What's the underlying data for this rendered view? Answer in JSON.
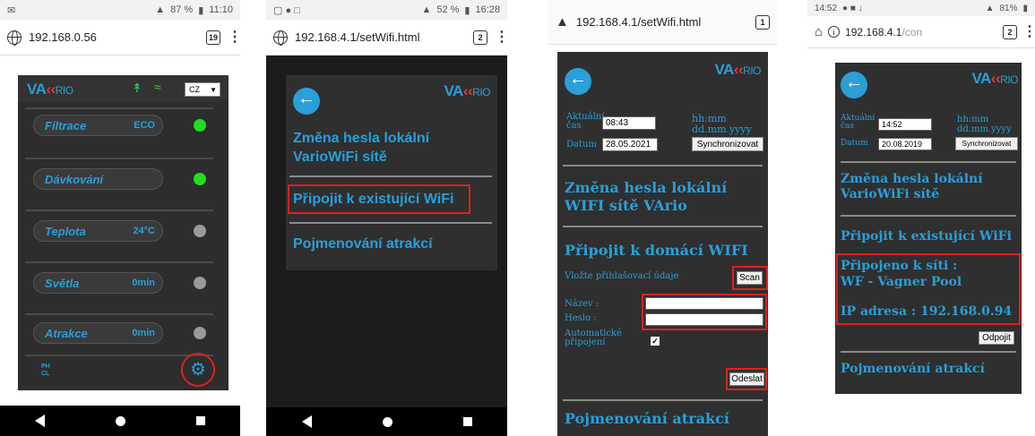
{
  "colors": {
    "accent": "#2a9fd8",
    "green": "#22dd22",
    "grey_dot": "#9a9a9a",
    "highlight": "#e0201e",
    "panel": "#2f2f2f"
  },
  "phone1": {
    "status_time": "11:10",
    "status_battery": "87 %",
    "url": "192.168.0.56",
    "tab_count": "19",
    "logo": {
      "va": "VA",
      "rio": "RIO"
    },
    "language": "CZ",
    "rows": [
      {
        "label": "Filtrace",
        "value": "ECO",
        "status": "on"
      },
      {
        "label": "Dávkování",
        "value": "",
        "status": "on"
      },
      {
        "label": "Teplota",
        "value": "24°C",
        "status": "off"
      },
      {
        "label": "Světla",
        "value": "0min",
        "status": "off"
      },
      {
        "label": "Atrakce",
        "value": "0min",
        "status": "off"
      }
    ],
    "ph_icon": "PH CL",
    "settings_icon": "gear-icon"
  },
  "phone2": {
    "status_time": "16:28",
    "status_battery": "52 %",
    "url": "192.168.4.1/setWifi.html",
    "tab_count": "2",
    "menu": [
      "Změna hesla lokální VarioWiFi sítě",
      "Připojit k existující WiFi",
      "Pojmenování atrakcí"
    ]
  },
  "phone3": {
    "url": "192.168.4.1/setWifi.html",
    "tab_count": "1",
    "time_label": "Aktuální čas",
    "time_value": "08:43",
    "time_format": "hh:mm",
    "date_label": "Datum",
    "date_value": "28.05.2021",
    "date_format": "dd.mm.yyyy",
    "sync_button": "Synchronizovat",
    "section1": "Změna hesla lokální WIFI sítě VArio",
    "section2": "Připojit k domácí WIFI",
    "login_prompt": "Vložte přihlašovací údaje",
    "scan_button": "Scan",
    "name_label": "Název :",
    "name_value": "",
    "password_label": "Heslo :",
    "password_value": "",
    "auto_label": "Automatické připojení",
    "auto_checked": true,
    "send_button": "Odeslat",
    "section3": "Pojmenování atrakcí"
  },
  "phone4": {
    "status_time": "14:52",
    "status_battery": "81%",
    "url_host": "192.168.4.1",
    "url_path": "/con",
    "tab_count": "2",
    "time_label": "Aktuální čas",
    "time_value": "14:52",
    "time_format": "hh:mm",
    "date_label": "Datum",
    "date_value": "20.08.2019",
    "date_format": "dd.mm.yyyy",
    "sync_button": "Synchronizovat",
    "section1": "Změna hesla lokální VarioWiFi sítě",
    "section2": "Připojit k existující WiFi",
    "connected_label": "Připojeno k síti :",
    "network_name": "WF - Vagner Pool",
    "ip_label": "IP adresa : 192.168.0.94",
    "disconnect_button": "Odpojit",
    "section3": "Pojmenování atrakcí"
  }
}
